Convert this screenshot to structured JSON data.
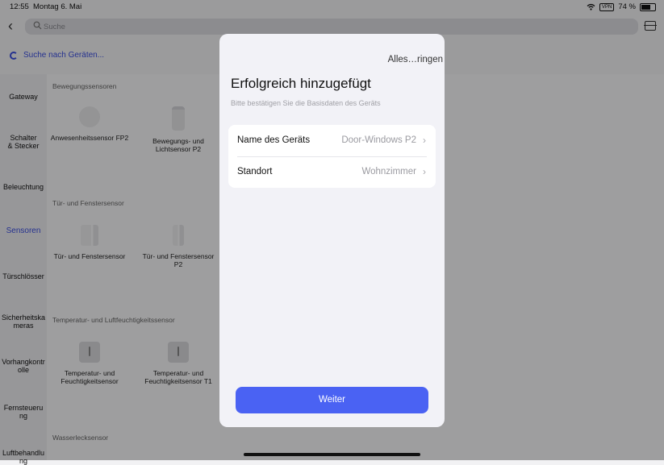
{
  "status": {
    "time": "12:55",
    "date": "Montag 6. Mai",
    "vpn": "VPN",
    "battery": "74 %"
  },
  "search": {
    "placeholder": "Suche"
  },
  "scan_text": "Suche nach Geräten...",
  "sidebar": {
    "gateway": "Gateway",
    "switches": "Schalter\n& Stecker",
    "lighting": "Beleuchtung",
    "sensors": "Sensoren",
    "locks": "Türschlösser",
    "cameras": "Sicherheitska\nmeras",
    "curtains": "Vorhangkontr\nolle",
    "remote": "Fernsteueru\nng",
    "air": "Luftbehandlu\nng"
  },
  "sections": {
    "motion": "Bewegungssensoren",
    "door": "Tür- und Fenstersensor",
    "temp": "Temperatur- und Luftfeuchtigkeitssensor",
    "water": "Wasserlecksensor"
  },
  "devices": {
    "fp2": "Anwesenheitssensor FP2",
    "p2motion": "Bewegungs- und\nLichtsensor P2",
    "door1": "Tür- und Fenstersensor",
    "door2": "Tür- und Fenstersensor\nP2",
    "temp1": "Temperatur- und\nFeuchtigkeitsensor",
    "temp2": "Temperatur- und\nFeuchtigkeitsensor T1"
  },
  "modal": {
    "corner_text": "Alles…ringen",
    "title": "Erfolgreich hinzugefügt",
    "subtitle": "Bitte bestätigen Sie die Basisdaten des Geräts",
    "name_label": "Name des Geräts",
    "name_value": "Door-Windows P2",
    "location_label": "Standort",
    "location_value": "Wohnzimmer",
    "next_button": "Weiter"
  },
  "colors": {
    "accent": "#4a62f3",
    "active_text": "#3c4fe0"
  }
}
